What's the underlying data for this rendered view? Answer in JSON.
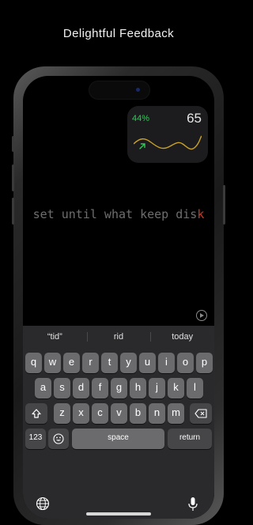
{
  "headline": "Delightful Feedback",
  "widget": {
    "trend_icon": "arrow-up-right-icon",
    "accuracy": "44%",
    "wpm": "65",
    "accent_color": "#34c759"
  },
  "typing": {
    "typed_text": "set until what keep dis",
    "current_char": "k",
    "typed_color": "#6e6e6e",
    "current_color": "#c0392b"
  },
  "suggestions": [
    "“tid”",
    "rid",
    "today"
  ],
  "keyboard": {
    "row1": [
      "q",
      "w",
      "e",
      "r",
      "t",
      "y",
      "u",
      "i",
      "o",
      "p"
    ],
    "row2": [
      "a",
      "s",
      "d",
      "f",
      "g",
      "h",
      "j",
      "k",
      "l"
    ],
    "row3": [
      "z",
      "x",
      "c",
      "v",
      "b",
      "n",
      "m"
    ],
    "numbers_label": "123",
    "space_label": "space",
    "return_label": "return",
    "shift_icon": "shift-icon",
    "delete_icon": "delete-icon",
    "emoji_icon": "emoji-icon",
    "globe_icon": "globe-icon",
    "mic_icon": "microphone-icon"
  }
}
